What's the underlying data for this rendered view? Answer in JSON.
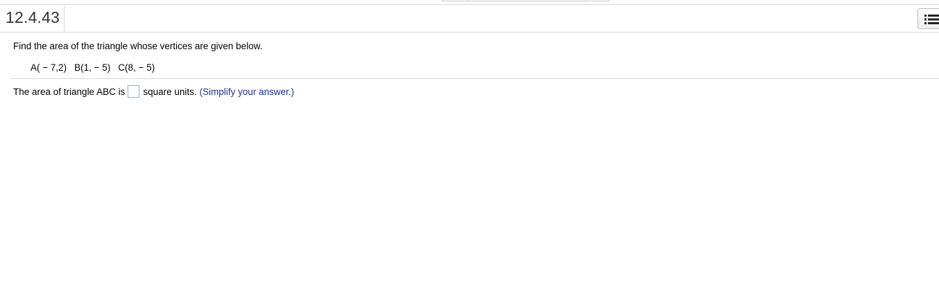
{
  "header": {
    "question_id": "12.4.43"
  },
  "question": {
    "prompt": "Find the area of the triangle whose vertices are given below.",
    "vertices": [
      "A( − 7,2)",
      "B(1, − 5)",
      "C(8, − 5)"
    ]
  },
  "answer": {
    "prefix": "The area of triangle ABC is",
    "input_value": "",
    "suffix": "square units.",
    "hint": "(Simplify your answer.)"
  },
  "icons": {
    "menu": "list-menu-icon"
  },
  "colors": {
    "hint_text": "#1d2f9c",
    "input_border": "#7fb0d6"
  }
}
